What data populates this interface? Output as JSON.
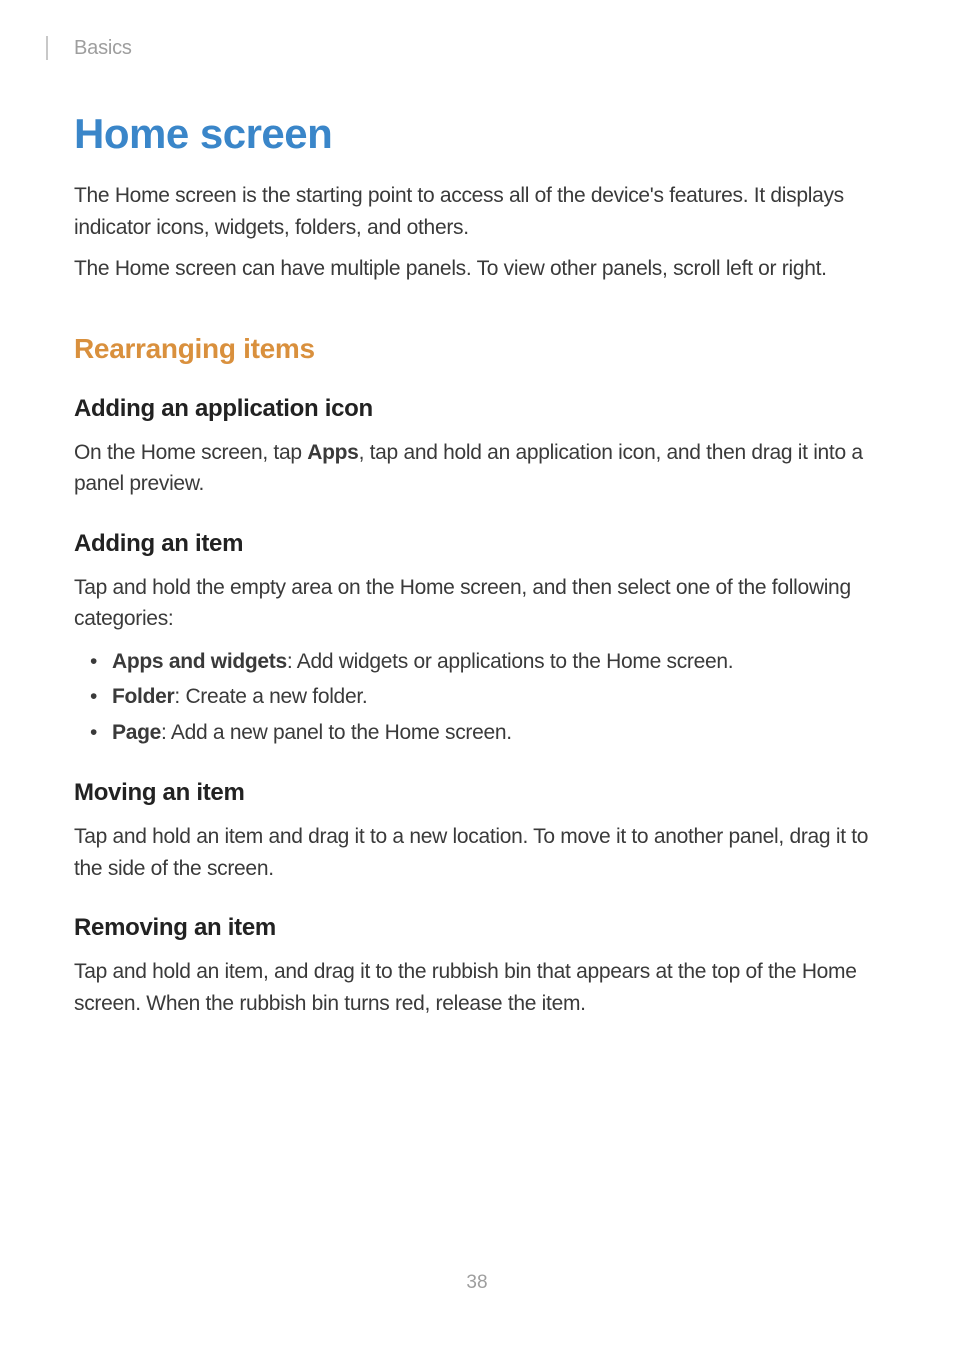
{
  "breadcrumb": "Basics",
  "title": "Home screen",
  "intro1": "The Home screen is the starting point to access all of the device's features. It displays indicator icons, widgets, folders, and others.",
  "intro2": "The Home screen can have multiple panels. To view other panels, scroll left or right.",
  "section1": {
    "heading": "Rearranging items",
    "sub1": {
      "heading": "Adding an application icon",
      "p_pre": "On the Home screen, tap ",
      "p_bold": "Apps",
      "p_post": ", tap and hold an application icon, and then drag it into a panel preview."
    },
    "sub2": {
      "heading": "Adding an item",
      "p": "Tap and hold the empty area on the Home screen, and then select one of the following categories:",
      "items": [
        {
          "bold": "Apps and widgets",
          "rest": ": Add widgets or applications to the Home screen."
        },
        {
          "bold": "Folder",
          "rest": ": Create a new folder."
        },
        {
          "bold": "Page",
          "rest": ": Add a new panel to the Home screen."
        }
      ]
    },
    "sub3": {
      "heading": "Moving an item",
      "p": "Tap and hold an item and drag it to a new location. To move it to another panel, drag it to the side of the screen."
    },
    "sub4": {
      "heading": "Removing an item",
      "p": "Tap and hold an item, and drag it to the rubbish bin that appears at the top of the Home screen. When the rubbish bin turns red, release the item."
    }
  },
  "page_number": "38"
}
